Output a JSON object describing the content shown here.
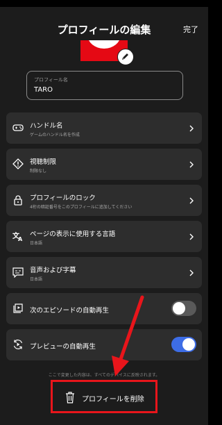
{
  "header": {
    "title": "プロフィールの編集",
    "done_label": "完了"
  },
  "profile": {
    "avatar_color": "#e50914",
    "name_label": "プロフィール名",
    "name_value": "TARO"
  },
  "settings": [
    {
      "icon": "gamepad-icon",
      "title": "ハンドル名",
      "subtitle": "ゲームのハンドル名を作成"
    },
    {
      "icon": "maturity-warning-icon",
      "title": "視聴制限",
      "subtitle": "制限なし"
    },
    {
      "icon": "lock-icon",
      "title": "プロフィールのロック",
      "subtitle": "4桁の暗証番号をこのプロフィールに追加してください"
    },
    {
      "icon": "language-icon",
      "title": "ページの表示に使用する言語",
      "subtitle": "日本語"
    },
    {
      "icon": "subtitles-icon",
      "title": "音声および字幕",
      "subtitle": "日本語"
    }
  ],
  "toggles": [
    {
      "icon": "autoplay-next-icon",
      "title": "次のエピソードの自動再生",
      "enabled": false
    },
    {
      "icon": "autoplay-preview-icon",
      "title": "プレビューの自動再生",
      "enabled": true
    }
  ],
  "footer_note": "ここで変更した内容は、すべてのデバイスに反映されます。",
  "delete_label": "プロフィールを削除",
  "colors": {
    "background": "#1c1c1c",
    "card": "#2d2d2d",
    "toggle_on": "#3d6de6",
    "toggle_off": "#5a5a5a",
    "highlight": "#e8151b"
  }
}
